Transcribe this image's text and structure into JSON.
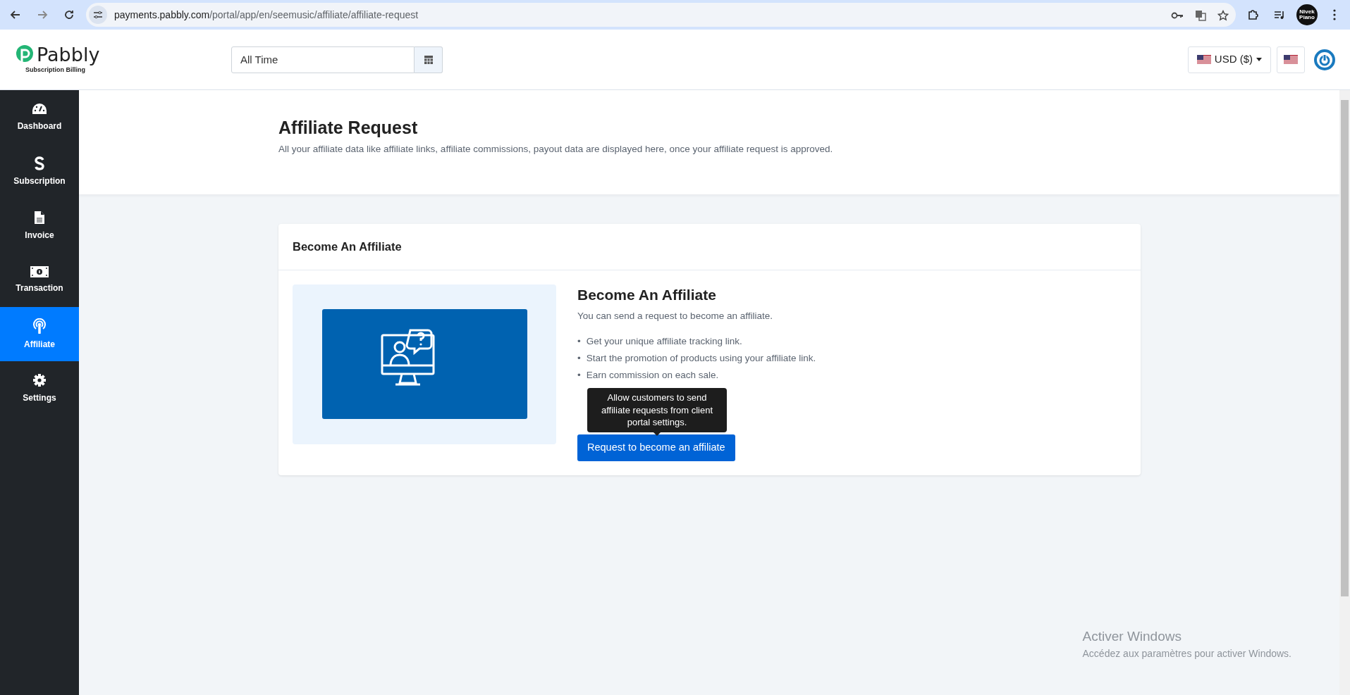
{
  "browser": {
    "url_host": "payments.pabbly.com",
    "url_path": "/portal/app/en/seemusic/affiliate/affiliate-request",
    "profile": "Nivek Piano"
  },
  "header": {
    "logo": "Pabbly",
    "logo_sub": "Subscription Billing",
    "date_range": "All Time",
    "currency": "USD ($)"
  },
  "sidebar": {
    "items": [
      {
        "label": "Dashboard",
        "selected": false
      },
      {
        "label": "Subscription",
        "selected": false
      },
      {
        "label": "Invoice",
        "selected": false
      },
      {
        "label": "Transaction",
        "selected": false
      },
      {
        "label": "Affiliate",
        "selected": true
      },
      {
        "label": "Settings",
        "selected": false
      }
    ]
  },
  "page": {
    "title": "Affiliate Request",
    "description": "All your affiliate data like affiliate links, affiliate commissions, payout data are displayed here, once your affiliate request is approved."
  },
  "card": {
    "header": "Become An Affiliate",
    "heading": "Become An Affiliate",
    "intro": "You can send a request to become an affiliate.",
    "bullet_marker": "•",
    "bullets": [
      "Get your unique affiliate tracking link.",
      "Start the promotion of products using your affiliate link.",
      "Earn commission on each sale."
    ],
    "button": "Request to become an affiliate",
    "tooltip": "Allow customers to send affiliate requests from client portal settings."
  },
  "os_notice": {
    "title": "Activer Windows",
    "subtitle": "Accédez aux paramètres pour activer Windows."
  }
}
